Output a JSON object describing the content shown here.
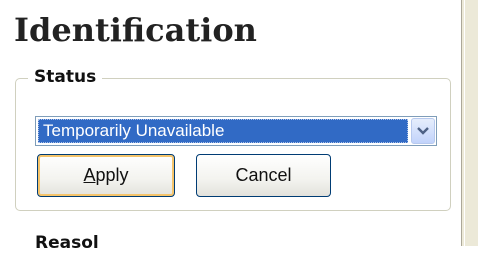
{
  "panel": {
    "title": "Identification",
    "status_group": {
      "legend": "Status",
      "select": {
        "value": "Temporarily Unavailable",
        "arrow_icon": "chevron-down-icon"
      },
      "apply_button": {
        "mnemonic": "A",
        "label_rest": "pply"
      },
      "cancel_button": {
        "label": "Cancel"
      }
    },
    "next_group": {
      "legend_partial": "Reasol"
    }
  },
  "colors": {
    "selection_bg": "#316ac5",
    "selection_text": "#ffffff",
    "button_border": "#003c74",
    "default_focus": "#f5c46b",
    "groupbox_border": "#d0d0bf",
    "window_chrome": "#ece9d8"
  }
}
